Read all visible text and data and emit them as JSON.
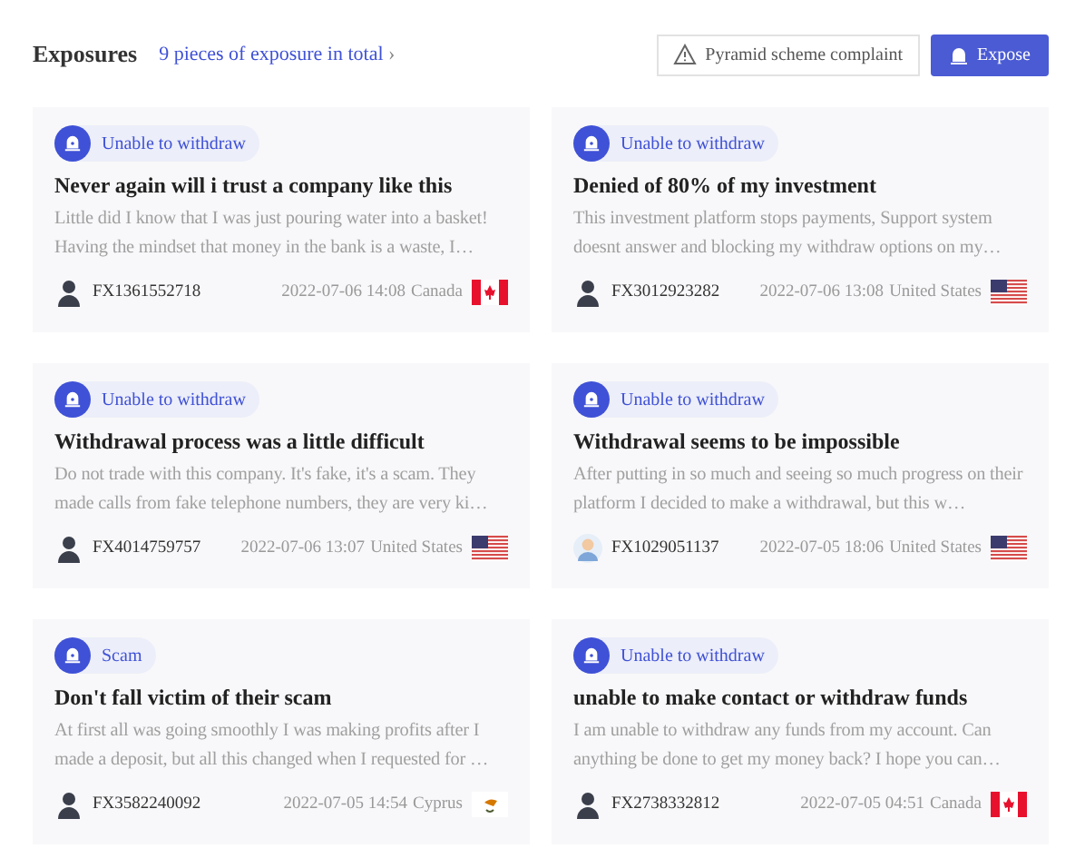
{
  "header": {
    "title": "Exposures",
    "total_link": "9 pieces of exposure in total",
    "total_chevron": "›",
    "complaint_button": "Pyramid scheme complaint",
    "expose_button": "Expose"
  },
  "exposures": [
    {
      "tag": "Unable to withdraw",
      "title": "Never again will i trust a company like this",
      "excerpt": "Little did I know that I was just pouring water into a basket! Having the mindset that money in the bank is a waste, I…",
      "user": "FX1361552718",
      "avatar": {
        "kind": "dark"
      },
      "date": "2022-07-06 14:08",
      "country": "Canada",
      "flag": {
        "kind": "ca"
      }
    },
    {
      "tag": "Unable to withdraw",
      "title": "Denied of 80% of my investment",
      "excerpt": "This investment platform stops payments, Support system doesnt answer and blocking my withdraw options on my…",
      "user": "FX3012923282",
      "avatar": {
        "kind": "dark"
      },
      "date": "2022-07-06 13:08",
      "country": "United States",
      "flag": {
        "kind": "us"
      }
    },
    {
      "tag": "Unable to withdraw",
      "title": "Withdrawal process was a little difficult",
      "excerpt": "Do not trade with this company. It's fake, it's a scam. They made calls from fake telephone numbers, they are very ki…",
      "user": "FX4014759757",
      "avatar": {
        "kind": "dark"
      },
      "date": "2022-07-06 13:07",
      "country": "United States",
      "flag": {
        "kind": "us"
      }
    },
    {
      "tag": "Unable to withdraw",
      "title": "Withdrawal seems to be impossible",
      "excerpt": "After putting in so much and seeing so much progress on their platform I decided to make a withdrawal, but this w…",
      "user": "FX1029051137",
      "avatar": {
        "kind": "light"
      },
      "date": "2022-07-05 18:06",
      "country": "United States",
      "flag": {
        "kind": "us"
      }
    },
    {
      "tag": "Scam",
      "title": "Don't fall victim of their scam",
      "excerpt": "At first all was going smoothly I was making profits after I made a deposit, but all this changed when I requested for …",
      "user": "FX3582240092",
      "avatar": {
        "kind": "dark"
      },
      "date": "2022-07-05 14:54",
      "country": "Cyprus",
      "flag": {
        "kind": "cy"
      }
    },
    {
      "tag": "Unable to withdraw",
      "title": "unable to make contact or withdraw funds",
      "excerpt": "I am unable to withdraw any funds from my account. Can anything be done to get my money back? I hope you can…",
      "user": "FX2738332812",
      "avatar": {
        "kind": "dark"
      },
      "date": "2022-07-05 04:51",
      "country": "Canada",
      "flag": {
        "kind": "ca"
      }
    }
  ]
}
